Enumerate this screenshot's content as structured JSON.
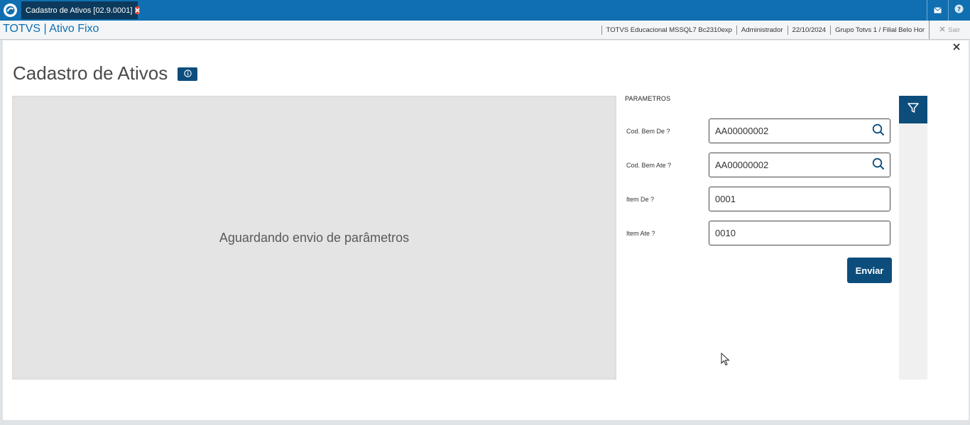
{
  "topbar": {
    "tab_label": "Cadastro de Ativos [02.9.0001]",
    "icons": [
      "totvs-logo-icon",
      "close-tab-icon",
      "mail-icon",
      "help-icon"
    ],
    "colors": {
      "bar": "#0f6fb0",
      "tab": "#0c3a5c",
      "close": "#e8463b"
    }
  },
  "appbar": {
    "title": "TOTVS | Ativo Fixo",
    "environment": "TOTVS Educacional MSSQL7 Bc2310exp",
    "user": "Administrador",
    "date": "22/10/2024",
    "branch": "Grupo Totvs 1 / Filial Belo Hor",
    "exit_label": "Sair"
  },
  "page": {
    "title": "Cadastro de Ativos",
    "preview_message": "Aguardando envio de parâmetros",
    "accent": "#0c4d7c"
  },
  "params": {
    "title": "PARAMETROS",
    "fields": [
      {
        "label": "Cod. Bem De ?",
        "value": "AA00000002"
      },
      {
        "label": "Cod. Bem Ate ?",
        "value": "AA00000002"
      },
      {
        "label": "Item De ?",
        "value": "0001"
      },
      {
        "label": "Item Ate ?",
        "value": "0010"
      }
    ],
    "submit_label": "Enviar"
  }
}
